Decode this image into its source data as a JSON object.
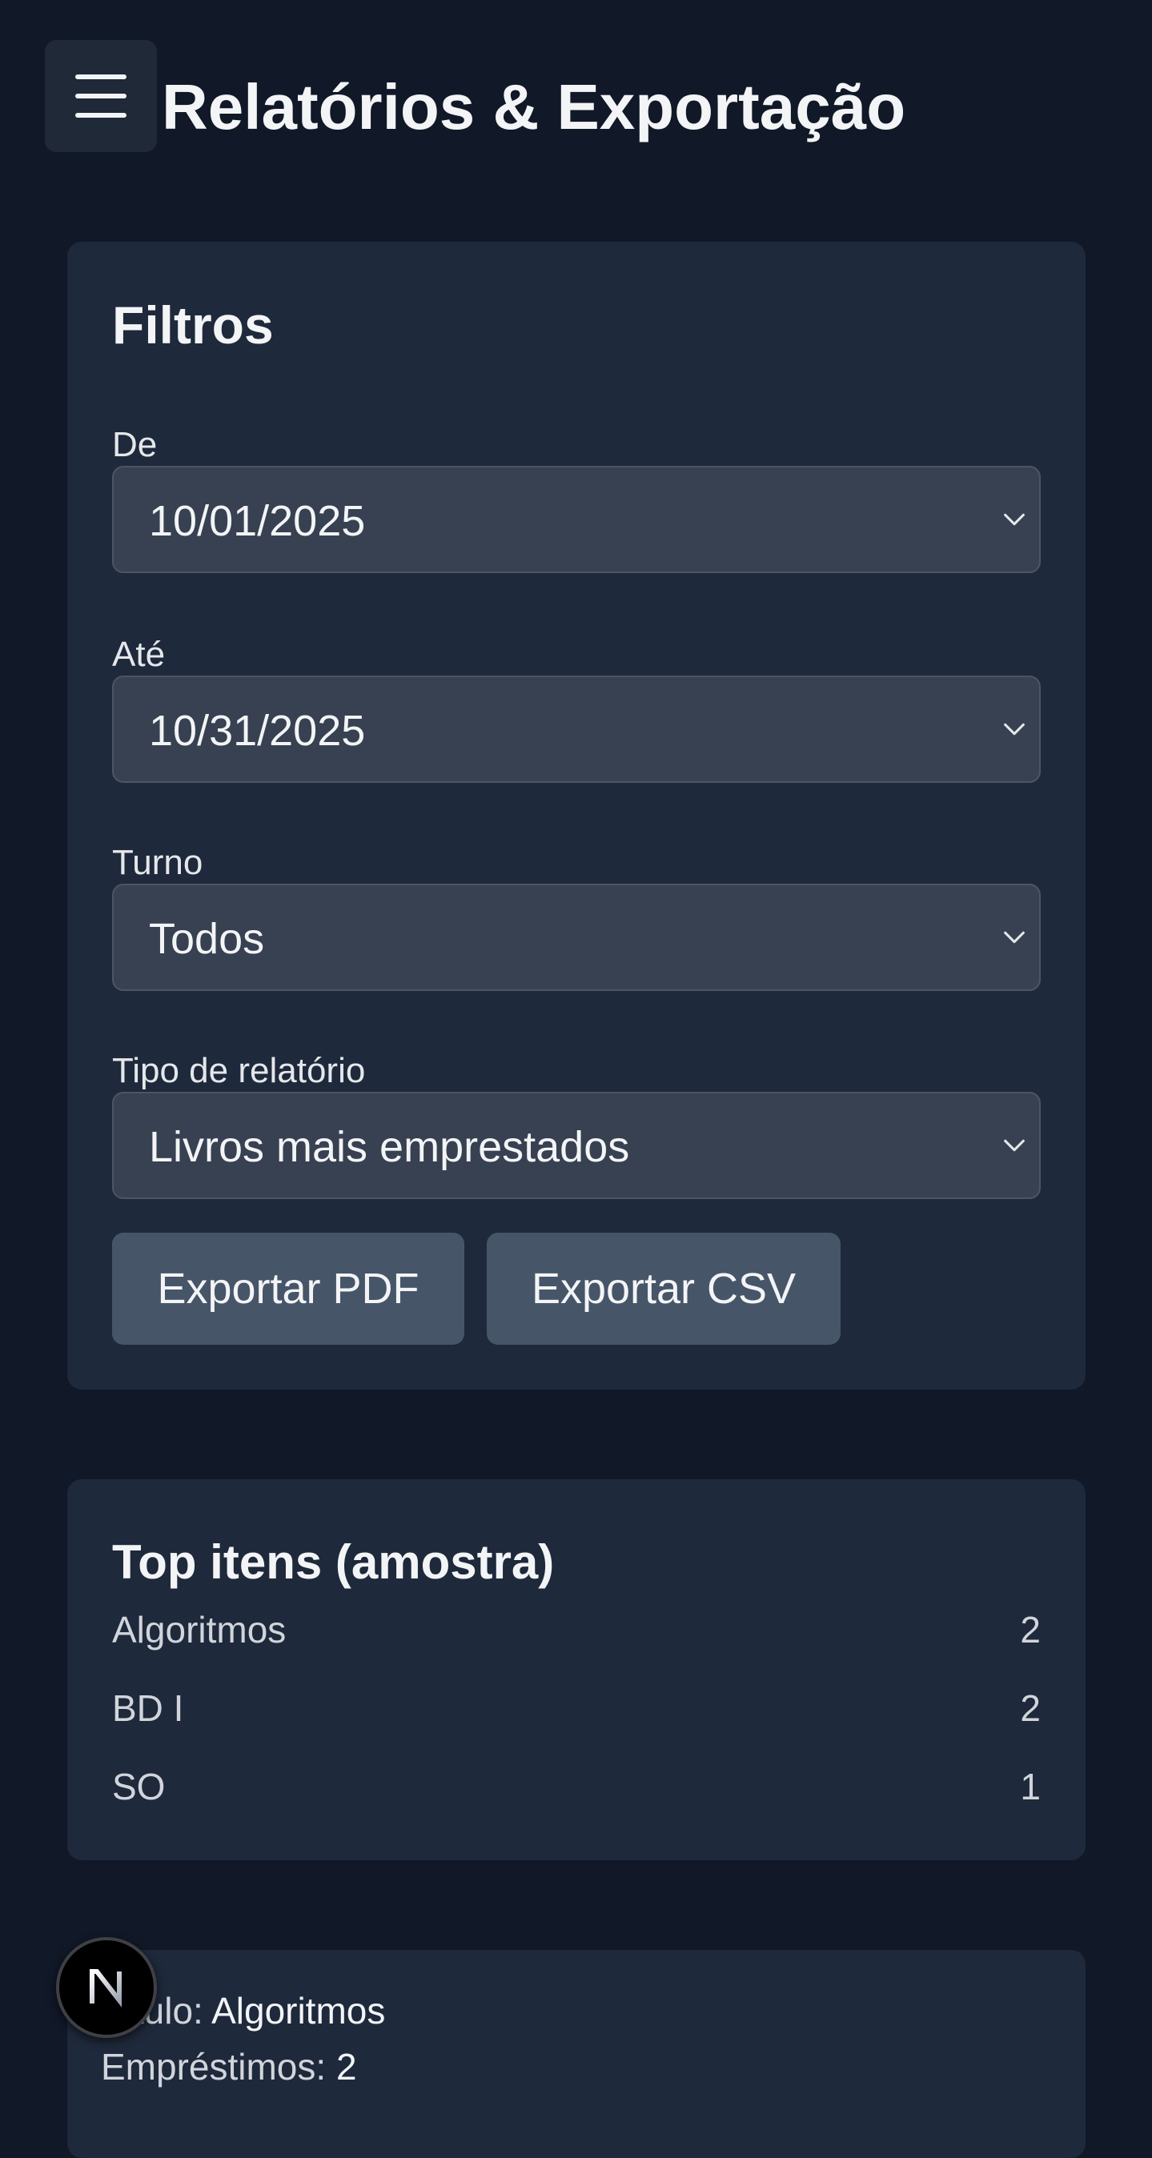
{
  "header": {
    "title": "Relatórios & Exportação",
    "menu_icon": "hamburger-menu-icon"
  },
  "filters": {
    "title": "Filtros",
    "from": {
      "label": "De",
      "value": "10/01/2025"
    },
    "to": {
      "label": "Até",
      "value": "10/31/2025"
    },
    "shift": {
      "label": "Turno",
      "value": "Todos"
    },
    "report_type": {
      "label": "Tipo de relatório",
      "value": "Livros mais emprestados"
    },
    "export_pdf_label": "Exportar PDF",
    "export_csv_label": "Exportar CSV"
  },
  "top_items": {
    "title": "Top itens (amostra)",
    "rows": [
      {
        "name": "Algoritmos",
        "count": "2"
      },
      {
        "name": "BD I",
        "count": "2"
      },
      {
        "name": "SO",
        "count": "1"
      }
    ]
  },
  "detail": {
    "title_label": "Título:",
    "title_value": "Algoritmos",
    "loans_label": "Empréstimos:",
    "loans_value": "2"
  },
  "dev_badge": {
    "letter": "N",
    "icon": "nextjs-logo-icon"
  },
  "colors": {
    "background": "#111827",
    "card": "#1e293b",
    "input": "#374151",
    "button": "#475569",
    "text": "#f3f4f6"
  }
}
